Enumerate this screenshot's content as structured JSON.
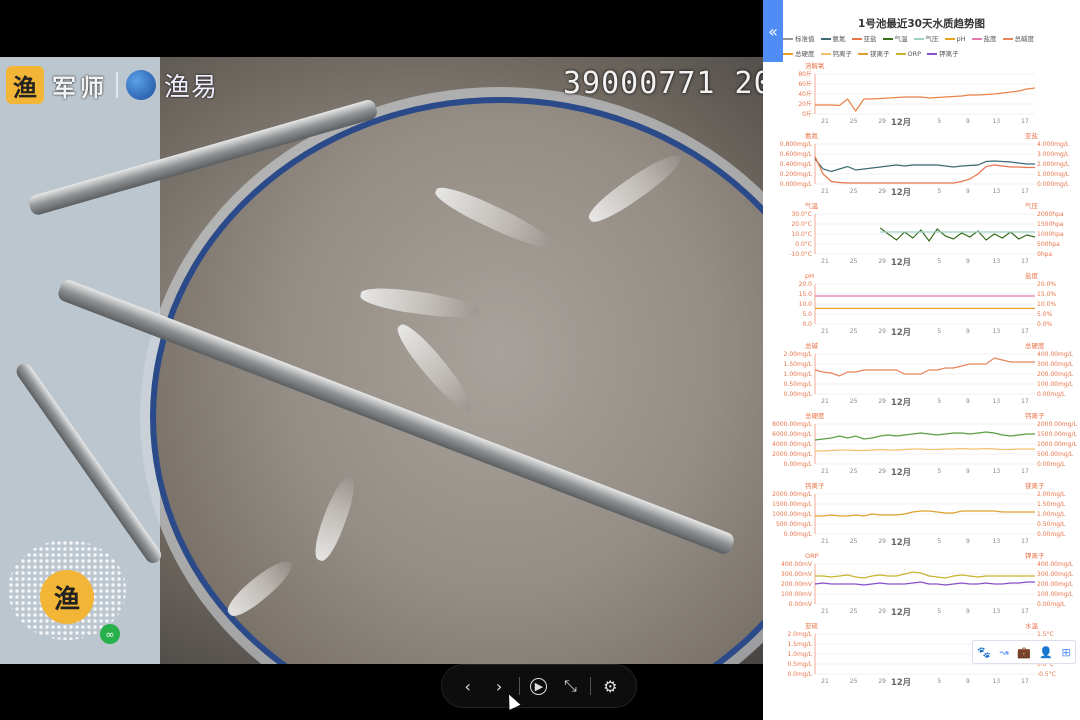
{
  "video": {
    "logo_badge": "渔",
    "logo_text": "军师",
    "brand": "渔易",
    "osd_text": "39000771 20",
    "qr_center": "渔",
    "controls": {
      "prev": "‹",
      "next": "›",
      "play": "▶",
      "fullscreen": "⤡",
      "settings": "⚙"
    }
  },
  "panel": {
    "collapse_icon": "«",
    "title": "1号池最近30天水质趋势图",
    "legend": [
      {
        "name": "标准值",
        "color": "#999999"
      },
      {
        "name": "氨氮",
        "color": "#3d6a73"
      },
      {
        "name": "亚盐",
        "color": "#e8744a"
      },
      {
        "name": "气温",
        "color": "#3a6b1f"
      },
      {
        "name": "气压",
        "color": "#9ed0c8"
      },
      {
        "name": "pH",
        "color": "#e8a020"
      },
      {
        "name": "盐度",
        "color": "#e87ab0"
      },
      {
        "name": "总碱度",
        "color": "#e8845a"
      },
      {
        "name": "总硬度",
        "color": "#e8a020"
      },
      {
        "name": "钙离子",
        "color": "#f0c070"
      },
      {
        "name": "镁离子",
        "color": "#e0a030"
      },
      {
        "name": "ORP",
        "color": "#c8b430"
      },
      {
        "name": "钾离子",
        "color": "#8a50c8"
      }
    ],
    "month_label": "12月",
    "x_ticks": [
      "21",
      "25",
      "29",
      "",
      "5",
      "9",
      "13",
      "17"
    ],
    "toolbox": [
      "🐾",
      "↝",
      "💼",
      "👤",
      "⊞"
    ]
  },
  "chart_data": [
    {
      "type": "line",
      "left_label": "溶解氧",
      "right_label": "",
      "left_ticks": [
        "80斤",
        "60斤",
        "40斤",
        "20斤",
        "0斤"
      ],
      "right_ticks": [],
      "ylim": [
        0,
        80
      ],
      "series": [
        {
          "color": "#e8844a",
          "values": [
            18,
            18,
            18,
            17,
            30,
            6,
            30,
            30,
            31,
            32,
            33,
            34,
            34,
            34,
            32,
            33,
            34,
            35,
            36,
            38,
            38,
            39,
            40,
            42,
            44,
            46,
            50,
            52
          ]
        }
      ]
    },
    {
      "type": "line",
      "left_label": "氨氮",
      "right_label": "亚盐",
      "left_ticks": [
        "0.800mg/L",
        "0.600mg/L",
        "0.400mg/L",
        "0.200mg/L",
        "0.000mg/L"
      ],
      "right_ticks": [
        "4.000mg/L",
        "3.000mg/L",
        "2.000mg/L",
        "1.000mg/L",
        "0.000mg/L"
      ],
      "ylim": [
        0,
        0.8
      ],
      "series": [
        {
          "color": "#3d6a73",
          "values": [
            0.5,
            0.3,
            0.25,
            0.3,
            0.35,
            0.28,
            0.3,
            0.32,
            0.34,
            0.36,
            0.38,
            0.36,
            0.38,
            0.38,
            0.38,
            0.38,
            0.36,
            0.34,
            0.36,
            0.37,
            0.38,
            0.45,
            0.46,
            0.45,
            0.44,
            0.42,
            0.4,
            0.4
          ]
        },
        {
          "color": "#e8744a",
          "values": [
            0.55,
            0.2,
            0.05,
            0.03,
            0.02,
            0.02,
            0.02,
            0.02,
            0.02,
            0.02,
            0.02,
            0.02,
            0.02,
            0.02,
            0.02,
            0.02,
            0.02,
            0.02,
            0.05,
            0.1,
            0.2,
            0.35,
            0.38,
            0.36,
            0.34,
            0.34,
            0.33,
            0.33
          ]
        }
      ]
    },
    {
      "type": "line",
      "left_label": "气温",
      "right_label": "气压",
      "left_ticks": [
        "30.0°C",
        "20.0°C",
        "10.0°C",
        "0.0°C",
        "-10.0°C"
      ],
      "right_ticks": [
        "2000hpa",
        "1500hpa",
        "1000hpa",
        "500hpa",
        "0hpa"
      ],
      "ylim": [
        -10,
        30
      ],
      "series": [
        {
          "color": "#3a6b1f",
          "values": [
            null,
            null,
            null,
            null,
            null,
            null,
            null,
            null,
            16,
            10,
            4,
            12,
            6,
            14,
            3,
            15,
            8,
            5,
            11,
            7,
            13,
            4,
            10,
            6,
            12,
            5,
            9,
            7
          ]
        },
        {
          "color": "#9ed0c8",
          "values": [
            null,
            null,
            null,
            null,
            null,
            null,
            null,
            null,
            12,
            12,
            12,
            12,
            12,
            12,
            12,
            12,
            12,
            12,
            12,
            12,
            12,
            12,
            12,
            12,
            12,
            12,
            12,
            12
          ]
        }
      ]
    },
    {
      "type": "line",
      "left_label": "pH",
      "right_label": "盐度",
      "left_ticks": [
        "20.0",
        "15.0",
        "10.0",
        "5.0",
        "0.0"
      ],
      "right_ticks": [
        "20.0%",
        "15.0%",
        "10.0%",
        "5.0%",
        "0.0%"
      ],
      "ylim": [
        0,
        20
      ],
      "series": [
        {
          "color": "#e87ab0",
          "values": [
            14,
            14,
            14,
            14,
            14,
            14,
            14,
            14,
            14,
            14,
            14,
            14,
            14,
            14,
            14,
            14,
            14,
            14,
            14,
            14,
            14,
            14,
            14,
            14,
            14,
            14,
            14,
            14
          ]
        },
        {
          "color": "#e8a020",
          "values": [
            7.8,
            7.8,
            7.8,
            7.8,
            7.8,
            7.8,
            7.8,
            7.8,
            7.8,
            7.8,
            7.8,
            7.8,
            7.8,
            7.8,
            7.8,
            7.8,
            7.8,
            7.8,
            7.8,
            7.8,
            7.8,
            7.8,
            7.8,
            7.8,
            7.8,
            7.8,
            7.8,
            7.8
          ]
        }
      ]
    },
    {
      "type": "line",
      "left_label": "总碱",
      "right_label": "总硬度",
      "left_ticks": [
        "2.00mg/L",
        "1.50mg/L",
        "1.00mg/L",
        "0.50mg/L",
        "0.00mg/L"
      ],
      "right_ticks": [
        "400.00mg/L",
        "300.00mg/L",
        "200.00mg/L",
        "100.00mg/L",
        "0.00mg/L"
      ],
      "ylim": [
        0,
        2
      ],
      "series": [
        {
          "color": "#e8845a",
          "values": [
            1.2,
            1.1,
            1.05,
            0.9,
            1.1,
            1.1,
            1.2,
            1.2,
            1.2,
            1.2,
            1.2,
            1.0,
            1.0,
            1.0,
            1.2,
            1.2,
            1.3,
            1.3,
            1.4,
            1.5,
            1.5,
            1.5,
            1.8,
            1.7,
            1.6,
            1.6,
            1.6,
            1.6
          ]
        }
      ]
    },
    {
      "type": "line",
      "left_label": "总硬度",
      "right_label": "钙离子",
      "left_ticks": [
        "8000.00mg/L",
        "6000.00mg/L",
        "4000.00mg/L",
        "2000.00mg/L",
        "0.00mg/L"
      ],
      "right_ticks": [
        "2000.00mg/L",
        "1500.00mg/L",
        "1000.00mg/L",
        "500.00mg/L",
        "0.00mg/L"
      ],
      "ylim": [
        0,
        8000
      ],
      "series": [
        {
          "color": "#5aa040",
          "values": [
            4800,
            5000,
            5200,
            5600,
            5200,
            5600,
            5000,
            5200,
            5600,
            5800,
            5600,
            5800,
            6000,
            6200,
            6000,
            5800,
            6000,
            6200,
            6200,
            6000,
            6200,
            6400,
            6200,
            5800,
            5600,
            5800,
            6000,
            6000
          ]
        },
        {
          "color": "#f0c070",
          "values": [
            2600,
            2600,
            2700,
            2800,
            2800,
            2700,
            2700,
            2800,
            2900,
            2800,
            2800,
            2900,
            3000,
            3000,
            2900,
            2900,
            3000,
            3000,
            3100,
            3000,
            3000,
            3100,
            3000,
            2900,
            2900,
            3000,
            3000,
            3000
          ]
        }
      ]
    },
    {
      "type": "line",
      "left_label": "钙离子",
      "right_label": "镁离子",
      "left_ticks": [
        "2000.00mg/L",
        "1500.00mg/L",
        "1000.00mg/L",
        "500.00mg/L",
        "0.00mg/L"
      ],
      "right_ticks": [
        "2.00mg/L",
        "1.50mg/L",
        "1.00mg/L",
        "0.50mg/L",
        "0.00mg/L"
      ],
      "ylim": [
        0,
        2000
      ],
      "series": [
        {
          "color": "#e0a030",
          "values": [
            900,
            900,
            950,
            900,
            900,
            950,
            900,
            1000,
            950,
            950,
            950,
            1000,
            1100,
            1150,
            1150,
            1100,
            1050,
            1050,
            1150,
            1150,
            1150,
            1150,
            1150,
            1100,
            1100,
            1100,
            1100,
            1100
          ]
        }
      ]
    },
    {
      "type": "line",
      "left_label": "ORP",
      "right_label": "钾离子",
      "left_ticks": [
        "400.00mV",
        "300.00mV",
        "200.00mV",
        "100.00mV",
        "0.00mV"
      ],
      "right_ticks": [
        "400.00mg/L",
        "300.00mg/L",
        "200.00mg/L",
        "100.00mg/L",
        "0.00mg/L"
      ],
      "ylim": [
        0,
        400
      ],
      "series": [
        {
          "color": "#c8b430",
          "values": [
            280,
            280,
            270,
            280,
            290,
            270,
            260,
            280,
            290,
            280,
            280,
            300,
            320,
            310,
            280,
            270,
            260,
            280,
            290,
            280,
            270,
            280,
            280,
            280,
            280,
            280,
            280,
            280
          ]
        },
        {
          "color": "#8a50c8",
          "values": [
            200,
            210,
            200,
            200,
            200,
            200,
            190,
            200,
            210,
            200,
            200,
            200,
            210,
            220,
            200,
            200,
            190,
            200,
            210,
            200,
            200,
            210,
            200,
            200,
            210,
            210,
            220,
            220
          ]
        }
      ]
    },
    {
      "type": "line",
      "left_label": "亚硫",
      "right_label": "水温",
      "left_ticks": [
        "2.0mg/L",
        "1.5mg/L",
        "1.0mg/L",
        "0.5mg/L",
        "0.0mg/L"
      ],
      "right_ticks": [
        "1.5°C",
        "1.0°C",
        "0.5°C",
        "0.0°C",
        "-0.5°C"
      ],
      "ylim": [
        0,
        2
      ],
      "series": []
    }
  ]
}
